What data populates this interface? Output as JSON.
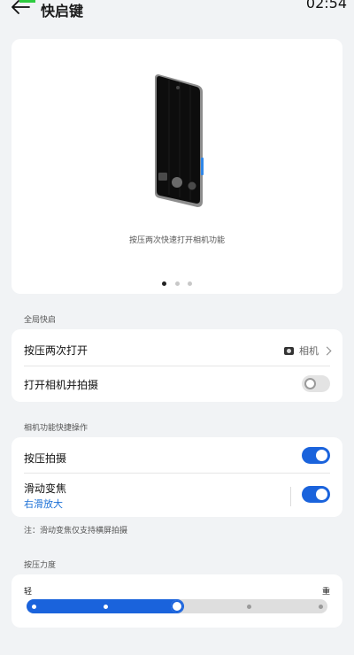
{
  "status_bar": {
    "time": "02:54"
  },
  "header": {
    "title": "快启键"
  },
  "hero": {
    "caption": "按压两次快速打开相机功能",
    "page_count": 3,
    "active_page": 1
  },
  "section_global": {
    "label": "全局快启"
  },
  "global_rows": {
    "double_press": {
      "label": "按压两次打开",
      "value": "相机"
    },
    "open_and_shoot": {
      "label": "打开相机并拍摄",
      "enabled": false
    }
  },
  "section_camera": {
    "label": "相机功能快捷操作"
  },
  "camera_rows": {
    "press_shoot": {
      "label": "按压拍摄",
      "enabled": true
    },
    "slide_zoom": {
      "label": "滑动变焦",
      "sublabel": "右滑放大",
      "enabled": true
    }
  },
  "footnote": "注：滑动变焦仅支持横屏拍摄",
  "section_pressure": {
    "label": "按压力度"
  },
  "pressure_slider": {
    "min_label": "轻",
    "max_label": "重",
    "steps": 5,
    "level": 3
  },
  "colors": {
    "accent": "#1a63dc",
    "link": "#1a6fd6",
    "background": "#f1f3f5"
  }
}
